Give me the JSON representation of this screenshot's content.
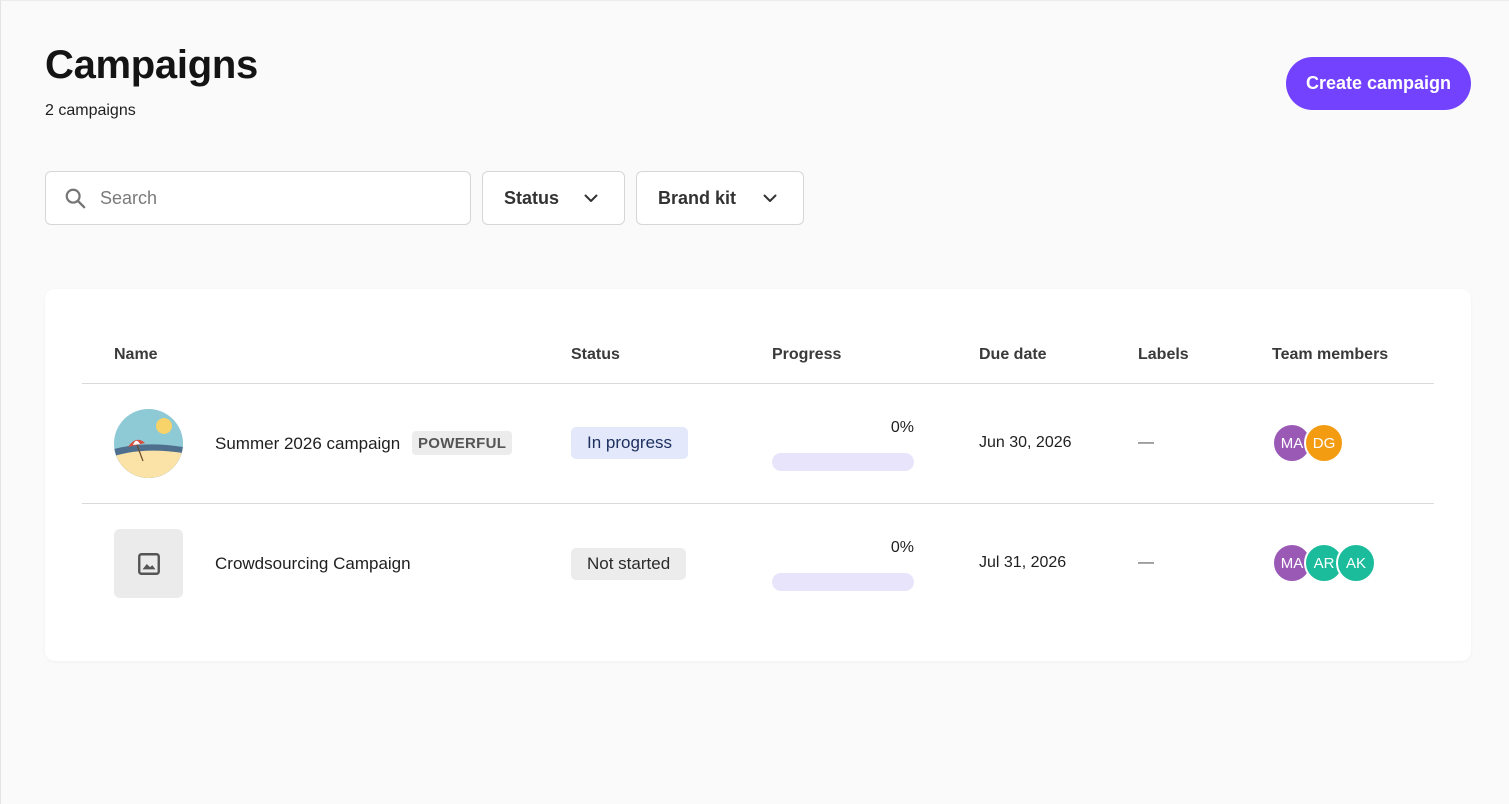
{
  "header": {
    "title": "Campaigns",
    "count_text": "2 campaigns",
    "create_button_label": "Create campaign"
  },
  "filters": {
    "search_placeholder": "Search",
    "search_value": "",
    "status_label": "Status",
    "brand_kit_label": "Brand kit"
  },
  "table": {
    "columns": [
      "Name",
      "Status",
      "Progress",
      "Due date",
      "Labels",
      "Team members"
    ],
    "rows": [
      {
        "name": "Summer 2026 campaign",
        "tag": "POWERFUL",
        "status": "In progress",
        "progress_text": "0%",
        "progress_value": 0,
        "due_date": "Jun 30, 2026",
        "labels": "—",
        "members": [
          {
            "initials": "MA",
            "color": "#9b59b6"
          },
          {
            "initials": "DG",
            "color": "#f39c12"
          }
        ]
      },
      {
        "name": "Crowdsourcing Campaign",
        "tag": "",
        "status": "Not started",
        "progress_text": "0%",
        "progress_value": 0,
        "due_date": "Jul 31, 2026",
        "labels": "—",
        "members": [
          {
            "initials": "MA",
            "color": "#9b59b6"
          },
          {
            "initials": "AR",
            "color": "#1abc9c"
          },
          {
            "initials": "AK",
            "color": "#1abc9c"
          }
        ]
      }
    ]
  },
  "colors": {
    "accent": "#7342ff",
    "status_in_progress_bg": "#e3e9fb",
    "status_not_started_bg": "#ececec"
  },
  "icons": {
    "search": "search-icon",
    "dropdown": "chevron-down-icon",
    "placeholder_image": "image-icon"
  }
}
